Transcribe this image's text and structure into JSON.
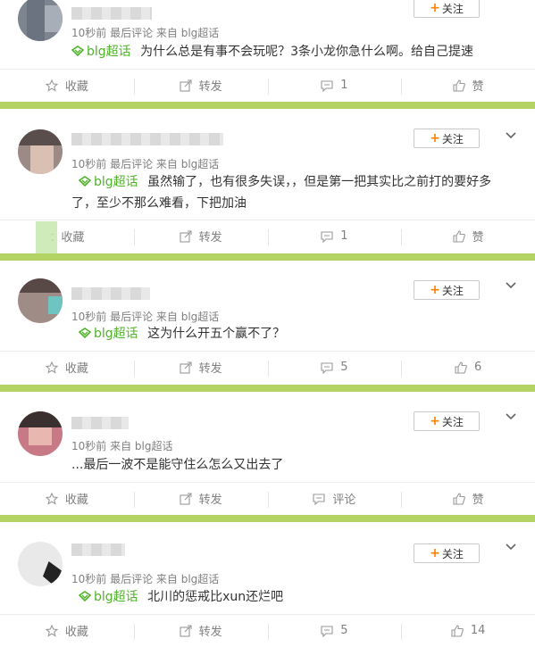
{
  "colors": {
    "accent": "#ff8200",
    "topic": "#4fb329",
    "separator": "#b3d465",
    "muted": "#808080"
  },
  "follow_label": "关注",
  "actions_labels": {
    "fav": "收藏",
    "fav_partial": "收藏",
    "repost": "转发",
    "comment": "评论",
    "like": "赞"
  },
  "posts": [
    {
      "meta": "10秒前  最后评论  来自 blg超话",
      "topic": "blg超话",
      "text": "为什么总是有事不会玩呢？3条小龙你急什么啊。给自己提速",
      "comments": "1",
      "likes": "赞"
    },
    {
      "meta": "10秒前  最后评论  来自 blg超话",
      "topic": "blg超话",
      "text": "虽然输了，也有很多失误，，但是第一把其实比之前打的要好多了，至少不那么难看，下把加油",
      "comments": "1",
      "likes": "赞",
      "fav": "：收藏"
    },
    {
      "meta": "10秒前  最后评论  来自 blg超话",
      "topic": "blg超话",
      "text": "这为什么开五个赢不了？",
      "comments": "5",
      "likes": "6"
    },
    {
      "meta": "10秒前  来自 blg超话",
      "topic": "",
      "text": "...最后一波不是能守住么怎么又出去了",
      "comments": "评论",
      "likes": "赞"
    },
    {
      "meta": "10秒前  最后评论  来自 blg超话",
      "topic": "blg超话",
      "text": "北川的惩戒比xun还烂吧",
      "comments": "5",
      "likes": "14"
    }
  ]
}
